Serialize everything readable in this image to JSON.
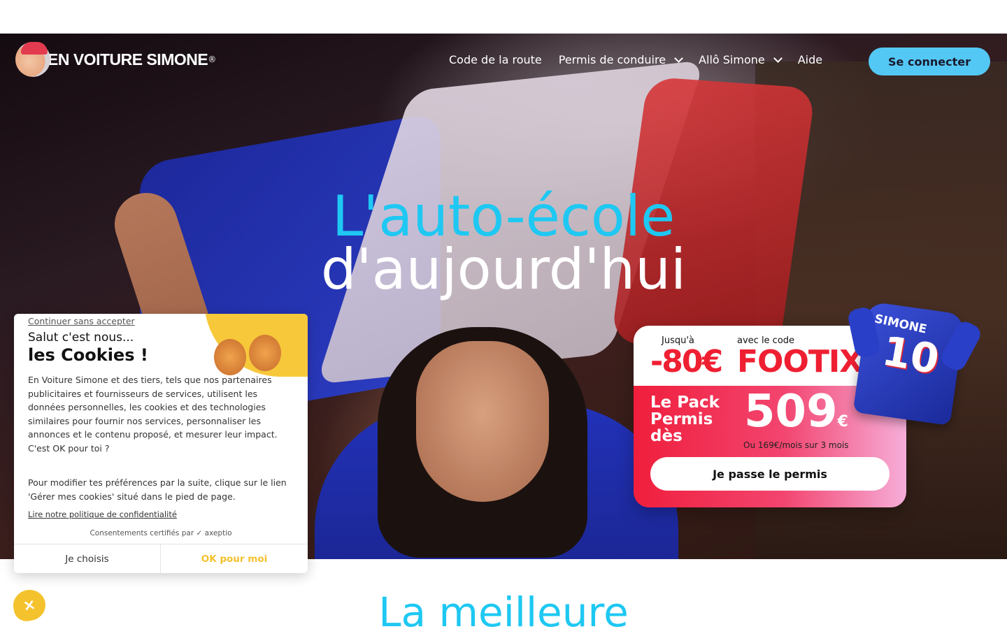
{
  "nav": {
    "brand": "EN VOITURE SIMONE",
    "brand_reg": "®",
    "items": [
      {
        "label": "Code de la route",
        "dropdown": false
      },
      {
        "label": "Permis de conduire",
        "dropdown": true
      },
      {
        "label": "Allô Simone",
        "dropdown": true
      },
      {
        "label": "Aide",
        "dropdown": false
      }
    ],
    "login": "Se connecter"
  },
  "hero": {
    "line1": "L'auto-école",
    "line2": "d'aujourd'hui"
  },
  "promo": {
    "upto_label": "Jusqu'à",
    "discount": "-80€",
    "code_label": "avec le code",
    "code": "FOOTIX",
    "pack_label": "Le Pack Permis dès",
    "price": "509",
    "currency": "€",
    "monthly": "Ou 169€/mois sur 3 mois",
    "cta": "Je passe le permis",
    "jersey_name": "SIMONE",
    "jersey_number": "10"
  },
  "section": {
    "title": "La meilleure"
  },
  "cookie": {
    "skip": "Continuer sans accepter",
    "hello": "Salut c'est nous...",
    "title": "les Cookies !",
    "body": "En Voiture Simone et des tiers, tels que nos partenaires publicitaires et fournisseurs de services, utilisent les données personnelles, les cookies et des technologies similaires pour fournir nos services, personnaliser les annonces et le contenu proposé, et mesurer leur impact. C'est OK pour toi ?",
    "body2": "Pour modifier tes préférences par la suite, clique sur le lien 'Gérer mes cookies' situé dans le pied de page.",
    "policy": "Lire notre politique de confidentialité",
    "certified": "Consentements certifiés par ✓ axeptio",
    "choose": "Je choisis",
    "ok": "OK pour moi",
    "close_icon": "×"
  },
  "colors": {
    "accent": "#1ec8f2",
    "login_bg": "#54c8f4",
    "promo_red": "#ef1f32",
    "cookie_yellow": "#f4c12e"
  }
}
